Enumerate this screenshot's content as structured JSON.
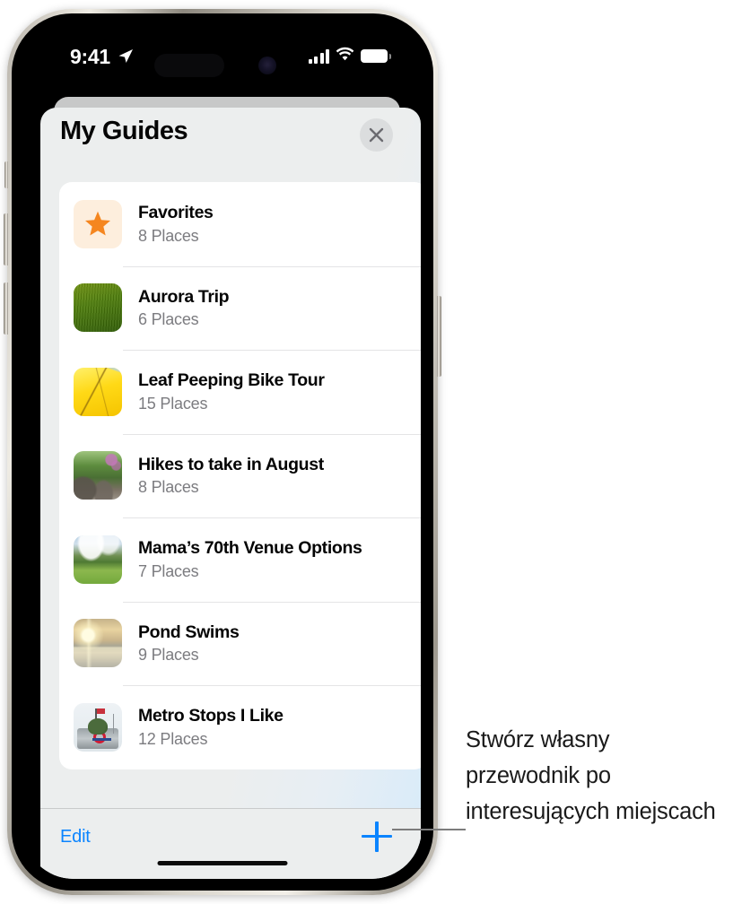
{
  "status_bar": {
    "time": "9:41",
    "location_icon": "location-arrow-icon",
    "cellular_icon": "cellular-bars-icon",
    "wifi_icon": "wifi-icon",
    "battery_icon": "battery-full-icon"
  },
  "sheet": {
    "title": "My Guides",
    "close_icon": "close-icon"
  },
  "guides": [
    {
      "title": "Favorites",
      "places": "8 Places",
      "thumb": "star-favorites-thumb"
    },
    {
      "title": "Aurora Trip",
      "places": "6 Places",
      "thumb": "green-field-thumb"
    },
    {
      "title": "Leaf Peeping Bike Tour",
      "places": "15 Places",
      "thumb": "yellow-leaves-thumb"
    },
    {
      "title": "Hikes to take in August",
      "places": "8 Places",
      "thumb": "forest-trail-thumb"
    },
    {
      "title": "Mama’s 70th Venue Options",
      "places": "7 Places",
      "thumb": "meadow-sky-thumb"
    },
    {
      "title": "Pond Swims",
      "places": "9 Places",
      "thumb": "sunset-lake-thumb"
    },
    {
      "title": "Metro Stops I Like",
      "places": "12 Places",
      "thumb": "metro-monument-thumb"
    }
  ],
  "toolbar": {
    "edit_label": "Edit",
    "add_icon": "plus-icon"
  },
  "callout": {
    "text": "Stwórz własny przewodnik po interesujących miejscach"
  },
  "colors": {
    "accent_blue": "#0a84ff",
    "favorites_star": "#f5861f",
    "sheet_background": "#eceeee",
    "card_background": "#ffffff",
    "subtitle_gray": "#7c7c80"
  }
}
